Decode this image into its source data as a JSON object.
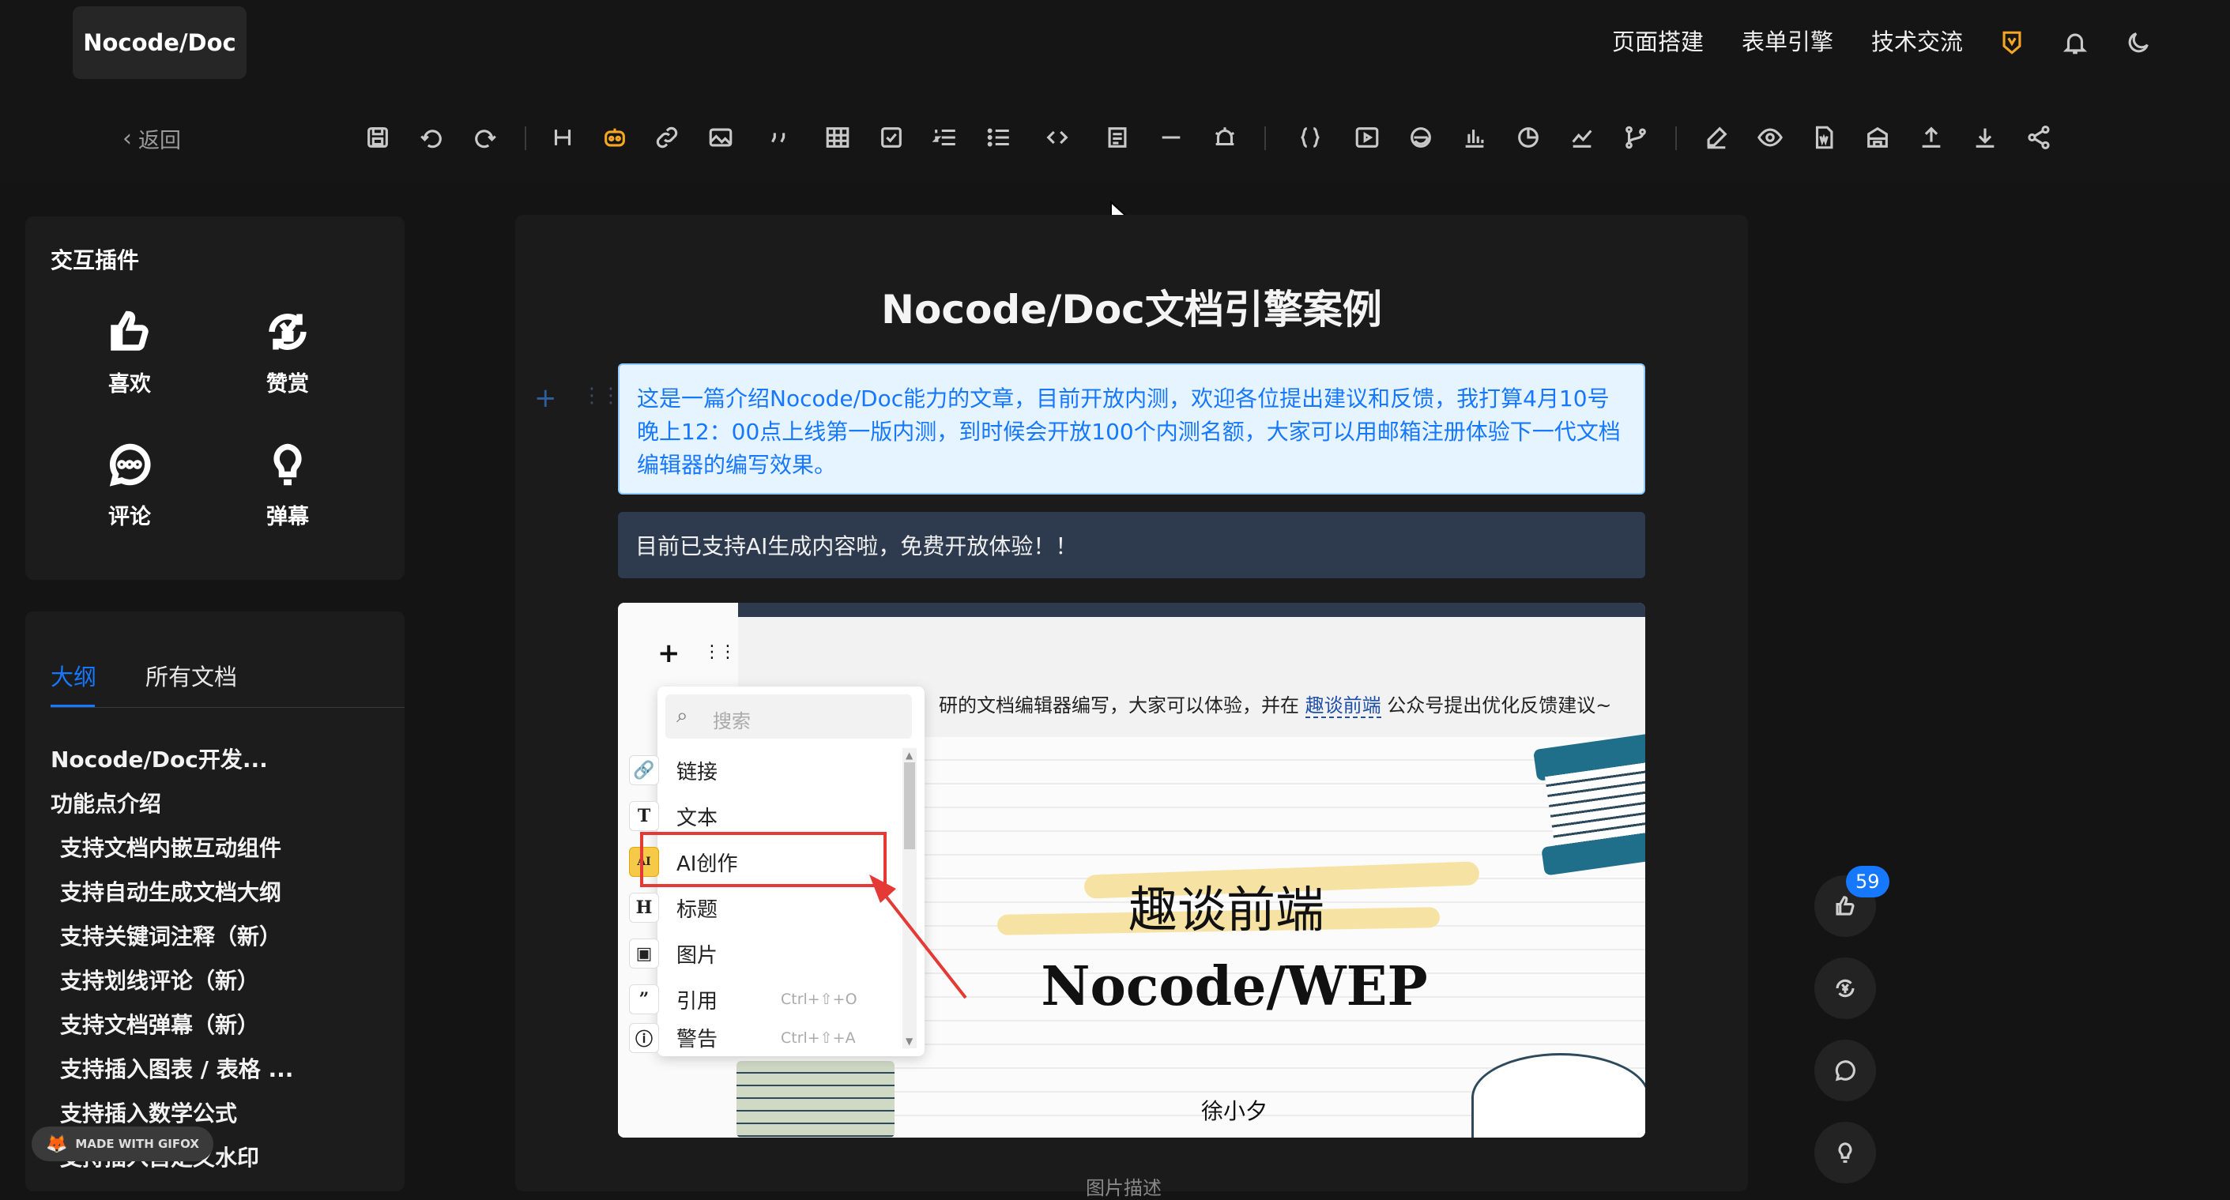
{
  "app": {
    "logo": "Nocode/Doc"
  },
  "topnav": {
    "items": [
      "页面搭建",
      "表单引擎",
      "技术交流"
    ]
  },
  "toolbar": {
    "back_label": "返回"
  },
  "interactive_plugins": {
    "title": "交互插件",
    "items": [
      {
        "label": "喜欢",
        "icon": "thumbs-up-icon"
      },
      {
        "label": "赞赏",
        "icon": "yuan-reward-icon"
      },
      {
        "label": "评论",
        "icon": "comment-bubble-icon"
      },
      {
        "label": "弹幕",
        "icon": "lightbulb-icon"
      }
    ]
  },
  "outline_panel": {
    "tabs": [
      "大纲",
      "所有文档"
    ],
    "active_tab": "大纲",
    "items": [
      "Nocode/Doc开发...",
      "功能点介绍",
      "支持文档内嵌互动组件",
      "支持自动生成文档大纲",
      "支持关键词注释（新）",
      "支持划线评论（新）",
      "支持文档弹幕（新）",
      "支持插入图表 / 表格 ...",
      "支持插入数学公式",
      "支持插入自定义水印"
    ]
  },
  "document": {
    "title": "Nocode/Doc文档引擎案例",
    "callout_info": "这是一篇介绍Nocode/Doc能力的文章，目前开放内测，欢迎各位提出建议和反馈，我打算4月10号晚上12：00点上线第一版内测，到时候会开放100个内测名额，大家可以用邮箱注册体验下一代文档编辑器的编写效果。",
    "callout_dark": "目前已支持AI生成内容啦，免费开放体验！！",
    "image_caption": "图片描述"
  },
  "embedded_editor": {
    "paragraph_prefix": "研的文档编辑器编写，大家可以体验，并在",
    "paragraph_link": "趣谈前端",
    "paragraph_suffix": "公众号提出优化反馈建议~",
    "cover_title": "趣谈前端",
    "cover_subtitle": "Nocode/WEP",
    "cover_author": "徐小夕",
    "slash_menu": {
      "search_placeholder": "搜索",
      "items": [
        {
          "label": "链接",
          "icon": "link-icon",
          "shortcut": ""
        },
        {
          "label": "文本",
          "icon": "text-T-icon",
          "shortcut": ""
        },
        {
          "label": "AI创作",
          "icon": "ai-doc-icon",
          "shortcut": "",
          "highlighted": true
        },
        {
          "label": "标题",
          "icon": "heading-H-icon",
          "shortcut": ""
        },
        {
          "label": "图片",
          "icon": "image-icon",
          "shortcut": ""
        },
        {
          "label": "引用",
          "icon": "quote-icon",
          "shortcut": "Ctrl+⇧+O"
        },
        {
          "label": "警告",
          "icon": "warning-icon",
          "shortcut": "Ctrl+⇧+A"
        }
      ]
    }
  },
  "side_actions": {
    "like_count": "59"
  },
  "watermark": "MADE WITH GIFOX",
  "colors": {
    "accent": "#1677ff",
    "highlight_box": "#e53935",
    "badge": "#1677ff"
  }
}
